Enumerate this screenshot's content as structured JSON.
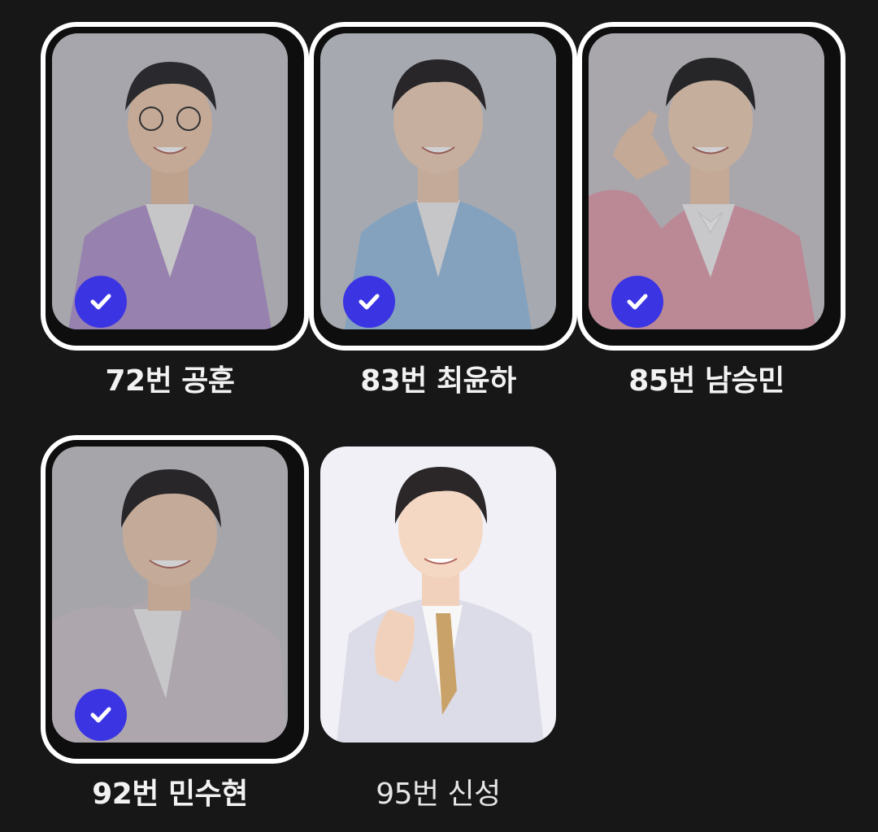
{
  "candidates": [
    {
      "label": "72번 공훈",
      "selected": true,
      "jacket_color": "#b79ad3",
      "bg_color": "#c9c9cf"
    },
    {
      "label": "83번 최윤하",
      "selected": true,
      "jacket_color": "#9ec4e6",
      "bg_color": "#cacdd3"
    },
    {
      "label": "85번 남승민",
      "selected": true,
      "jacket_color": "#e4a5b2",
      "bg_color": "#cfcbcf"
    },
    {
      "label": "92번 민수현",
      "selected": true,
      "jacket_color": "#d4c9d0",
      "bg_color": "#c9c8cc"
    },
    {
      "label": "95번 신성",
      "selected": false,
      "jacket_color": "#dcdce8",
      "bg_color": "#f1f0f6"
    }
  ],
  "colors": {
    "background": "#171717",
    "accent": "#3b34e3",
    "frame": "#ffffff"
  },
  "icons": {
    "selected_badge": "check-icon"
  }
}
